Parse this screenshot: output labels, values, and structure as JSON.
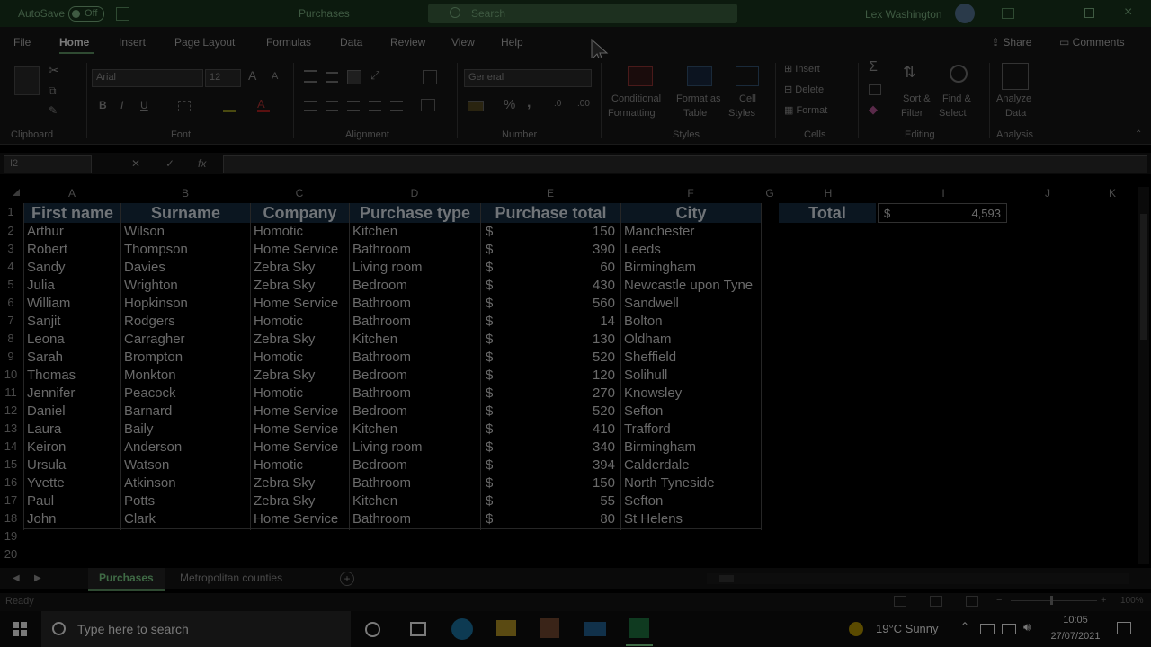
{
  "titlebar": {
    "autosave_label": "AutoSave",
    "autosave_state": "Off",
    "file_name": "Purchases",
    "search_placeholder": "Search",
    "user_name": "Lex Washington"
  },
  "menu_tabs": [
    "File",
    "Home",
    "Insert",
    "Page Layout",
    "Formulas",
    "Data",
    "Review",
    "View",
    "Help"
  ],
  "share_label": "Share",
  "comments_label": "Comments",
  "ribbon": {
    "clipboard": "Clipboard",
    "font": "Font",
    "font_name": "Arial",
    "font_size": "12",
    "alignment": "Alignment",
    "number": "Number",
    "number_format": "General",
    "styles": "Styles",
    "conditional": "Conditional",
    "formatting": "Formatting",
    "format_as": "Format as",
    "table": "Table",
    "cell": "Cell",
    "cell_styles": "Styles",
    "cells": "Cells",
    "insert": "Insert",
    "delete": "Delete",
    "format": "Format",
    "editing": "Editing",
    "sort": "Sort &",
    "filter": "Filter",
    "find": "Find &",
    "select": "Select",
    "analyze": "Analyze",
    "data": "Data",
    "analysis": "Analysis"
  },
  "name_box": "I2",
  "fx": "fx",
  "columns": [
    "A",
    "B",
    "C",
    "D",
    "E",
    "F",
    "G",
    "H",
    "I",
    "J",
    "K"
  ],
  "headers": [
    "First name",
    "Surname",
    "Company",
    "Purchase type",
    "Purchase total",
    "City"
  ],
  "rows": [
    [
      "Arthur",
      "Wilson",
      "Homotic",
      "Kitchen",
      "150",
      "Manchester"
    ],
    [
      "Robert",
      "Thompson",
      "Home Service",
      "Bathroom",
      "390",
      "Leeds"
    ],
    [
      "Sandy",
      "Davies",
      "Zebra Sky",
      "Living room",
      "60",
      "Birmingham"
    ],
    [
      "Julia",
      "Wrighton",
      "Zebra Sky",
      "Bedroom",
      "430",
      "Newcastle upon Tyne"
    ],
    [
      "William",
      "Hopkinson",
      "Home Service",
      "Bathroom",
      "560",
      "Sandwell"
    ],
    [
      "Sanjit",
      "Rodgers",
      "Homotic",
      "Bathroom",
      "14",
      "Bolton"
    ],
    [
      "Leona",
      "Carragher",
      "Zebra Sky",
      "Kitchen",
      "130",
      "Oldham"
    ],
    [
      "Sarah",
      "Brompton",
      "Homotic",
      "Bathroom",
      "520",
      "Sheffield"
    ],
    [
      "Thomas",
      "Monkton",
      "Zebra Sky",
      "Bedroom",
      "120",
      "Solihull"
    ],
    [
      "Jennifer",
      "Peacock",
      "Homotic",
      "Bathroom",
      "270",
      "Knowsley"
    ],
    [
      "Daniel",
      "Barnard",
      "Home Service",
      "Bedroom",
      "520",
      "Sefton"
    ],
    [
      "Laura",
      "Baily",
      "Home Service",
      "Kitchen",
      "410",
      "Trafford"
    ],
    [
      "Keiron",
      "Anderson",
      "Home Service",
      "Living room",
      "340",
      "Birmingham"
    ],
    [
      "Ursula",
      "Watson",
      "Homotic",
      "Bedroom",
      "394",
      "Calderdale"
    ],
    [
      "Yvette",
      "Atkinson",
      "Zebra Sky",
      "Bathroom",
      "150",
      "North Tyneside"
    ],
    [
      "Paul",
      "Potts",
      "Zebra Sky",
      "Kitchen",
      "55",
      "Sefton"
    ],
    [
      "John",
      "Clark",
      "Home Service",
      "Bathroom",
      "80",
      "St Helens"
    ]
  ],
  "currency": "$",
  "row_numbers": [
    "1",
    "2",
    "3",
    "4",
    "5",
    "6",
    "7",
    "8",
    "9",
    "10",
    "11",
    "12",
    "13",
    "14",
    "15",
    "16",
    "17",
    "18",
    "19",
    "20"
  ],
  "total_label": "Total",
  "total_value": "4,593",
  "sheet_tabs": [
    "Purchases",
    "Metropolitan counties"
  ],
  "status_text": "Ready",
  "zoom": "100%",
  "taskbar": {
    "search_placeholder": "Type here to search",
    "weather": "19°C  Sunny",
    "time": "10:05",
    "date": "27/07/2021"
  }
}
